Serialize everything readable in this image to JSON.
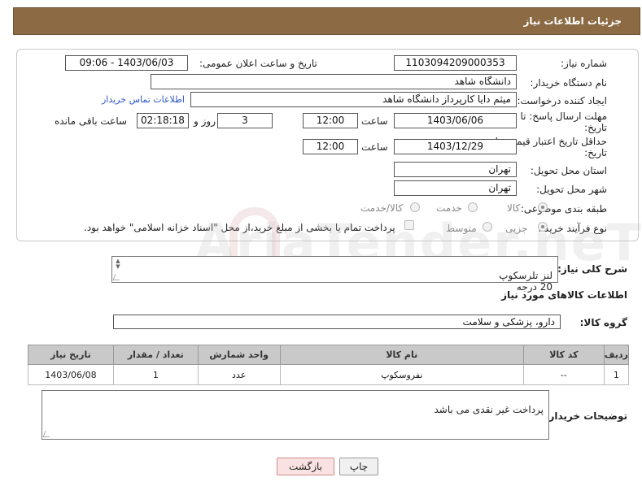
{
  "header": {
    "title": "جزئیات اطلاعات نیاز"
  },
  "form": {
    "need_number": {
      "label": "شماره نیاز:",
      "value": "1103094209000353"
    },
    "announce_date": {
      "label": "تاریخ و ساعت اعلان عمومی:",
      "value": "1403/06/03 - 09:06"
    },
    "buyer_org": {
      "label": "نام دستگاه خریدار:",
      "value": "دانشگاه شاهد"
    },
    "requester": {
      "label": "ایجاد کننده درخواست:",
      "value": "میثم دایا کارپرداز دانشگاه شاهد",
      "contact_link": "اطلاعات تماس خریدار"
    },
    "reply_deadline": {
      "label_line1": "مهلت ارسال پاسخ: تا",
      "label_line2": "تاریخ:",
      "date": "1403/06/06",
      "time_label": "ساعت",
      "time": "12:00",
      "days": "3",
      "days_label": "روز و",
      "remaining": "02:18:18",
      "remaining_label": "ساعت باقی مانده"
    },
    "price_validity": {
      "label_line1": "حداقل تاریخ اعتبار قیمت: تا",
      "label_line2": "تاریخ:",
      "date": "1403/12/29",
      "time_label": "ساعت",
      "time": "12:00"
    },
    "province": {
      "label": "استان محل تحویل:",
      "value": "تهران"
    },
    "city": {
      "label": "شهر محل تحویل:",
      "value": "تهران"
    },
    "category": {
      "label": "طبقه بندی موضوعی:",
      "options": [
        "کالا",
        "خدمت",
        "کالا/خدمت"
      ],
      "selected": "کالا"
    },
    "process_type": {
      "label": "نوع فرآیند خرید :",
      "options": [
        "جزیی",
        "متوسط"
      ],
      "selected": "جزیی",
      "note": "پرداخت تمام یا بخشی از مبلغ خرید،از محل \"اسناد خزانه اسلامی\" خواهد بود."
    }
  },
  "description": {
    "label": "شرح کلی نیاز:",
    "value": "لنز تلرسکوپ\n20 درجه"
  },
  "goods_section": {
    "title": "اطلاعات کالاهای مورد نیاز"
  },
  "goods_group": {
    "label": "گروه کالا:",
    "value": "دارو، پزشکی و سلامت"
  },
  "table": {
    "headers": [
      "ردیف",
      "کد کالا",
      "نام کالا",
      "واحد شمارش",
      "تعداد / مقدار",
      "تاریخ نیاز"
    ],
    "rows": [
      [
        "1",
        "--",
        "نفروسکوپ",
        "عدد",
        "1",
        "1403/06/08"
      ]
    ]
  },
  "buyer_notes": {
    "label": "توضیحات خریدار:",
    "value": "پرداخت غیر نقدی می باشد"
  },
  "buttons": {
    "print": "چاپ",
    "back": "بازگشت"
  },
  "watermark": "AriaTender.neT"
}
